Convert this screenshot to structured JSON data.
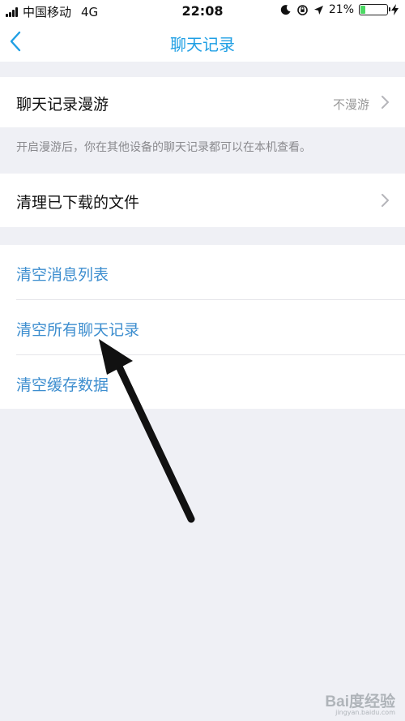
{
  "status_bar": {
    "carrier": "中国移动",
    "network": "4G",
    "time": "22:08",
    "battery": "21%",
    "battery_level": 0.21
  },
  "nav": {
    "title": "聊天记录",
    "back_icon": "chevron-left-icon"
  },
  "settings": {
    "roaming_label": "聊天记录漫游",
    "roaming_value": "不漫游",
    "roaming_hint": "开启漫游后，你在其他设备的聊天记录都可以在本机查看。",
    "clear_downloads_label": "清理已下载的文件"
  },
  "actions": [
    {
      "label": "清空消息列表"
    },
    {
      "label": "清空所有聊天记录"
    },
    {
      "label": "清空缓存数据"
    }
  ],
  "watermark": {
    "text": "Bai度经验",
    "url": "jingyan.baidu.com"
  },
  "colors": {
    "accent": "#1f9fe4",
    "action_text": "#3d8ecf",
    "background": "#eff0f5",
    "battery": "#4cd964"
  }
}
